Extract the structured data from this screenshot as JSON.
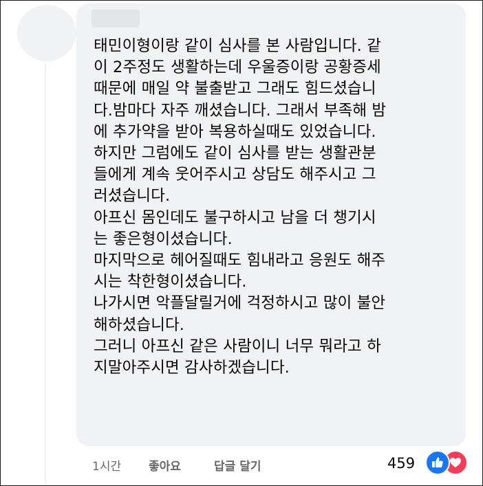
{
  "comment": {
    "lines": [
      "태민이형이랑 같이 심사를 본 사람입니다. 같",
      "이 2주정도 생활하는데 우울증이랑 공황증세",
      "때문에 매일 약 불출받고 그래도 힘드셨습니",
      "다.밤마다 자주 깨셨습니다. 그래서 부족해 밤",
      "에 추가약을 받아 복용하실때도 있었습니다.",
      "하지만 그럼에도 같이 심사를 받는 생활관분",
      "들에게 계속 웃어주시고 상담도 해주시고 그",
      "러셨습니다.",
      "아프신 몸인데도 불구하시고 남을 더 챙기시",
      "는 좋은형이셨습니다.",
      "마지막으로 헤어질때도 힘내라고 응원도 해주",
      "시는 착한형이셨습니다.",
      "나가시면 악플달릴거에 걱정하시고 많이 불안",
      "해하셨습니다.",
      "그러니 아프신 같은 사람이니 너무 뭐라고 하",
      "지말아주시면 감사하겠습니다."
    ]
  },
  "actions": {
    "time": "1시간",
    "like_label": "좋아요",
    "reply_label": "답글 달기",
    "reaction_count": "459",
    "reactions": [
      "like-icon",
      "love-icon"
    ]
  },
  "colors": {
    "bubble": "#f0f2f5",
    "text": "#050505",
    "meta": "#65676b",
    "like": "#1877f2",
    "love": "#f33e58"
  }
}
